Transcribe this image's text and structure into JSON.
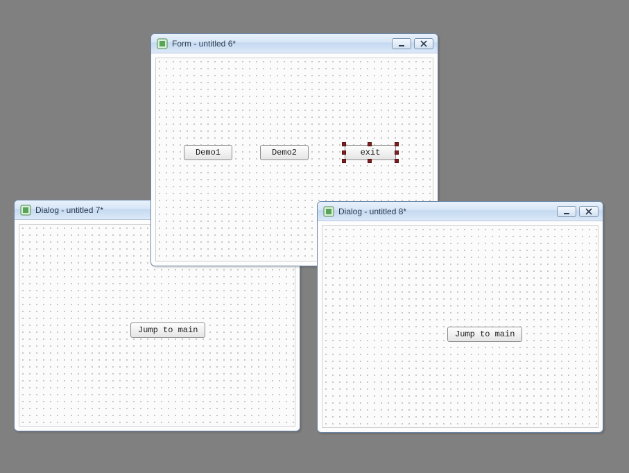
{
  "windows": {
    "form": {
      "title": "Form - untitled 6*",
      "buttons": {
        "demo1": "Demo1",
        "demo2": "Demo2",
        "exit": "exit"
      },
      "selected_button": "exit"
    },
    "dialog7": {
      "title": "Dialog - untitled 7*",
      "button_label": "Jump to main"
    },
    "dialog8": {
      "title": "Dialog - untitled 8*",
      "button_label": "Jump to main"
    }
  },
  "controls": {
    "minimize_tooltip": "Minimize",
    "close_tooltip": "Close"
  }
}
